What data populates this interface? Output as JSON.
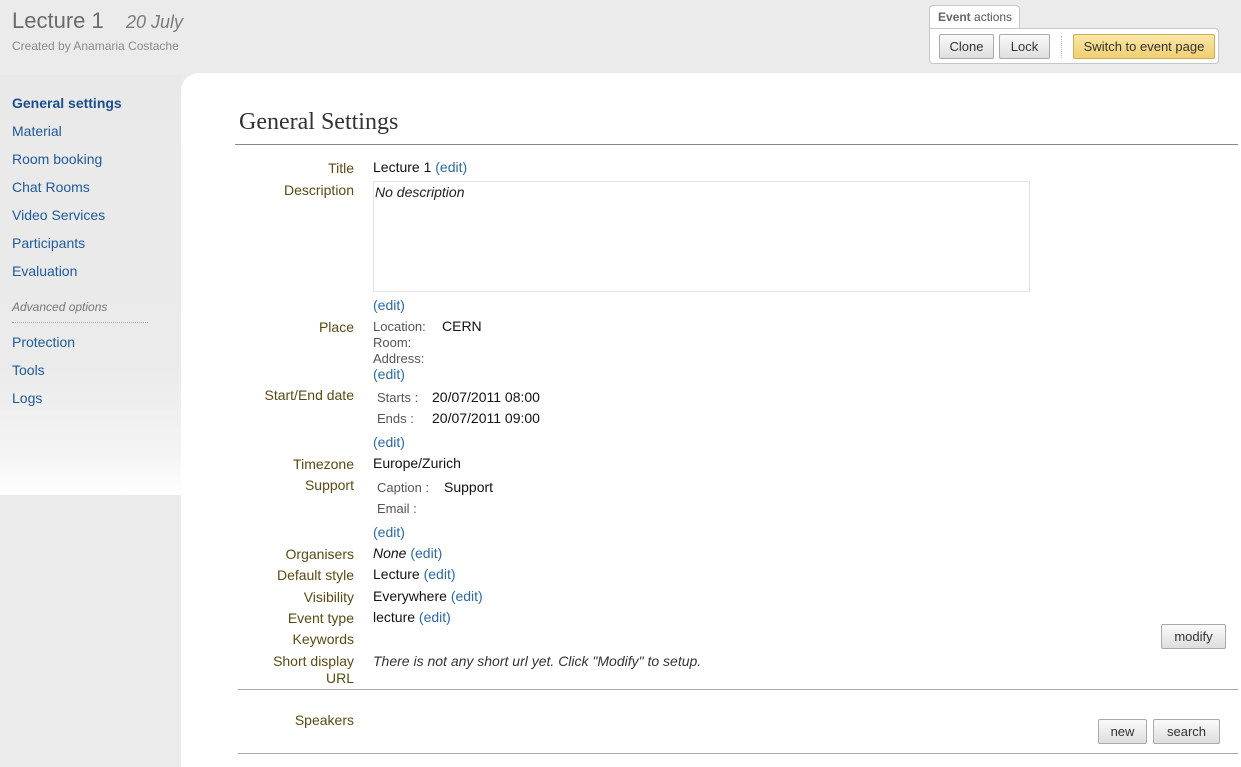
{
  "header": {
    "title": "Lecture 1",
    "date": "20 July",
    "created_by": "Created by Anamaria Costache"
  },
  "event_actions": {
    "tab_label_bold": "Event",
    "tab_label_rest": " actions",
    "clone": "Clone",
    "lock": "Lock",
    "switch": "Switch to event page"
  },
  "sidebar": {
    "items": [
      "General settings",
      "Material",
      "Room booking",
      "Chat Rooms",
      "Video Services",
      "Participants",
      "Evaluation"
    ],
    "advanced_heading": "Advanced options",
    "advanced_items": [
      "Protection",
      "Tools",
      "Logs"
    ]
  },
  "page": {
    "title": "General Settings",
    "edit": "(edit)",
    "labels": {
      "title": "Title",
      "description": "Description",
      "place": "Place",
      "start_end": "Start/End date",
      "timezone": "Timezone",
      "support": "Support",
      "organisers": "Organisers",
      "default_style": "Default style",
      "visibility": "Visibility",
      "event_type": "Event type",
      "keywords": "Keywords",
      "short_url_1": "Short display",
      "short_url_2": "URL",
      "speakers": "Speakers"
    },
    "values": {
      "title": "Lecture 1",
      "description": "No description",
      "location_label": "Location:",
      "location": "CERN",
      "room_label": "Room:",
      "address_label": "Address:",
      "starts_label": "Starts :",
      "starts": "20/07/2011 08:00",
      "ends_label": "Ends :",
      "ends": "20/07/2011 09:00",
      "timezone": "Europe/Zurich",
      "caption_label": "Caption :",
      "caption": "Support",
      "email_label": "Email :",
      "organisers": "None",
      "default_style": "Lecture",
      "visibility": "Everywhere",
      "event_type": "lecture",
      "short_url": "There is not any short url yet. Click \"Modify\" to setup."
    },
    "buttons": {
      "modify": "modify",
      "new": "new",
      "search": "search"
    }
  }
}
